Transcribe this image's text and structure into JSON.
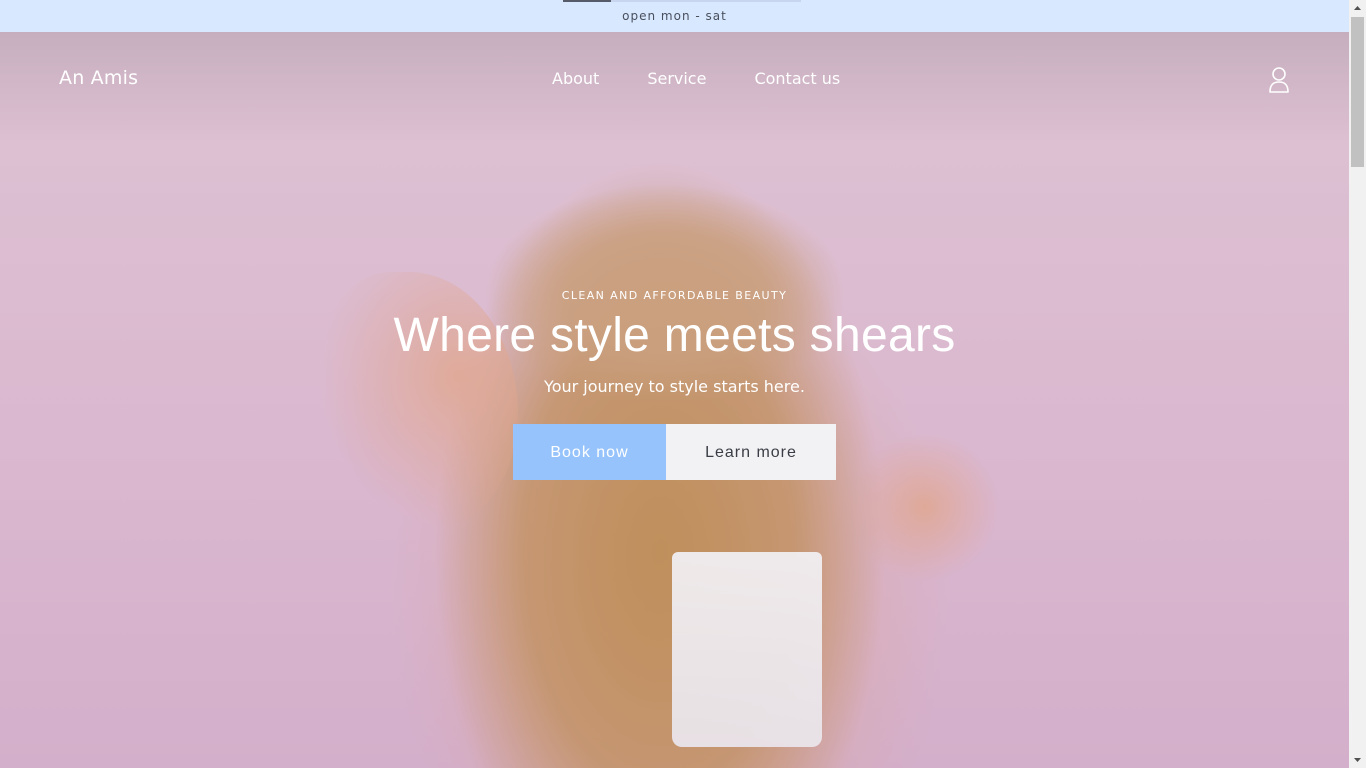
{
  "announcement": {
    "text": "open mon - sat"
  },
  "header": {
    "brand": "An Amis",
    "nav": [
      {
        "label": "About"
      },
      {
        "label": "Service"
      },
      {
        "label": "Contact us"
      }
    ],
    "account_icon": "user-icon"
  },
  "hero": {
    "eyebrow": "CLEAN AND AFFORDABLE BEAUTY",
    "title": "Where style meets shears",
    "subtitle": "Your journey to style starts here.",
    "primary_button": "Book now",
    "secondary_button": "Learn more",
    "background_image": "woman-with-long-wavy-hair-against-pink-wall"
  },
  "colors": {
    "announcement_bg": "#d7e8ff",
    "primary_button_bg": "#96c3fb",
    "secondary_button_bg": "#f2f2f4",
    "hero_bg": "#dab7cf"
  }
}
